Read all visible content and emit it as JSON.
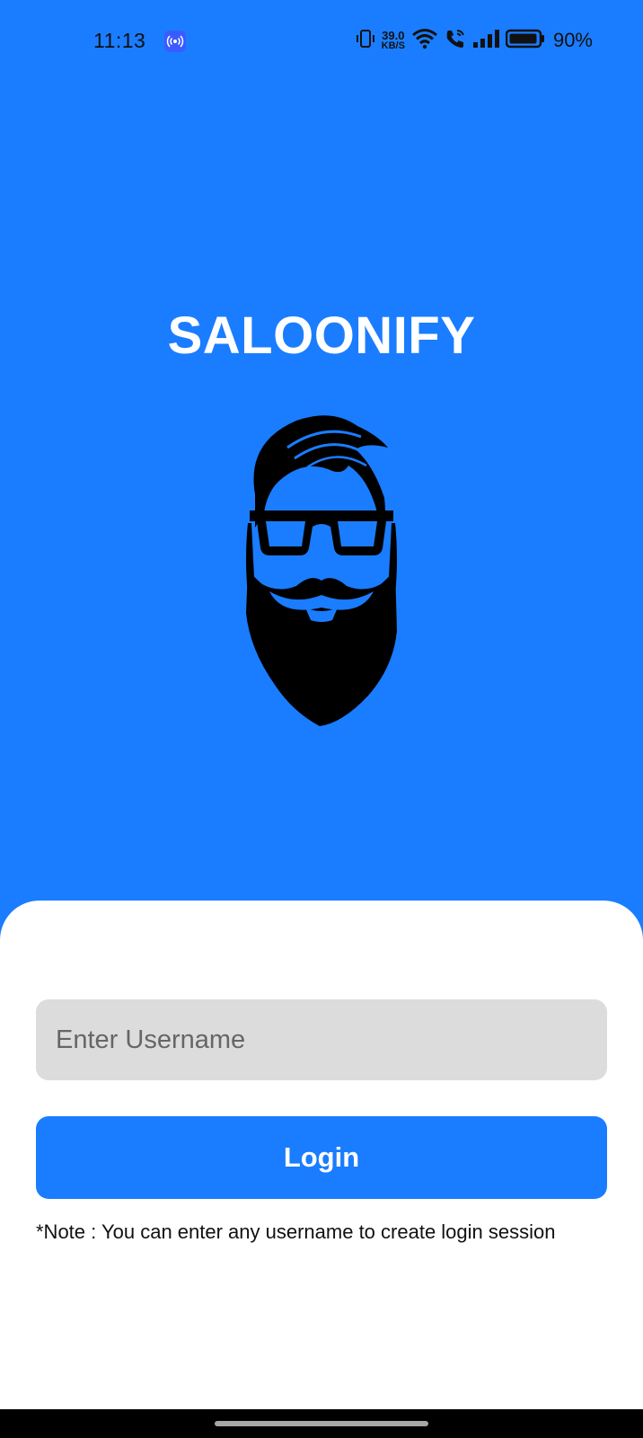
{
  "status_bar": {
    "time": "11:13",
    "net_speed_value": "39.0",
    "net_speed_unit": "KB/S",
    "battery_percent": "90%",
    "icons": [
      "hotspot-icon",
      "vibrate-icon",
      "wifi-icon",
      "wifi-call-icon",
      "signal-icon",
      "battery-icon"
    ]
  },
  "header": {
    "title": "SALOONIFY",
    "logo_icon": "bearded-man-logo"
  },
  "login": {
    "username_placeholder": "Enter Username",
    "username_value": "",
    "login_label": "Login",
    "note": "*Note : You can enter any username to create login session"
  },
  "colors": {
    "primary": "#1a7dff",
    "input_bg": "#dcdcdc",
    "card_bg": "#ffffff",
    "nav_bar": "#000000"
  }
}
